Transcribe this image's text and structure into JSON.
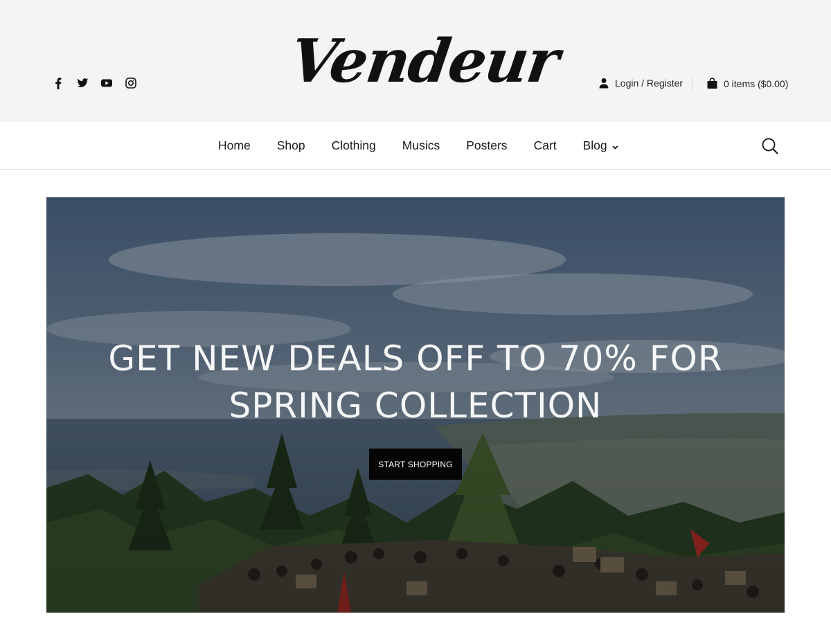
{
  "header": {
    "logo_text": "Vendeur",
    "socials": [
      {
        "icon": "facebook-icon"
      },
      {
        "icon": "twitter-icon"
      },
      {
        "icon": "youtube-icon"
      },
      {
        "icon": "instagram-icon"
      }
    ],
    "login_label": "Login / Register",
    "cart_label": "0 items ($0.00)"
  },
  "nav": {
    "items": [
      "Home",
      "Shop",
      "Clothing",
      "Musics",
      "Posters",
      "Cart",
      "Blog"
    ],
    "blog_has_dropdown": true,
    "search_icon": "search-icon"
  },
  "hero": {
    "title_line1": "GET NEW DEALS OFF TO 70% FOR",
    "title_line2": "SPRING COLLECTION",
    "cta_label": "START SHOPPING"
  },
  "colors": {
    "header_bg": "#f4f4f4",
    "cta_bg": "#050505",
    "text": "#1a1a1a"
  }
}
